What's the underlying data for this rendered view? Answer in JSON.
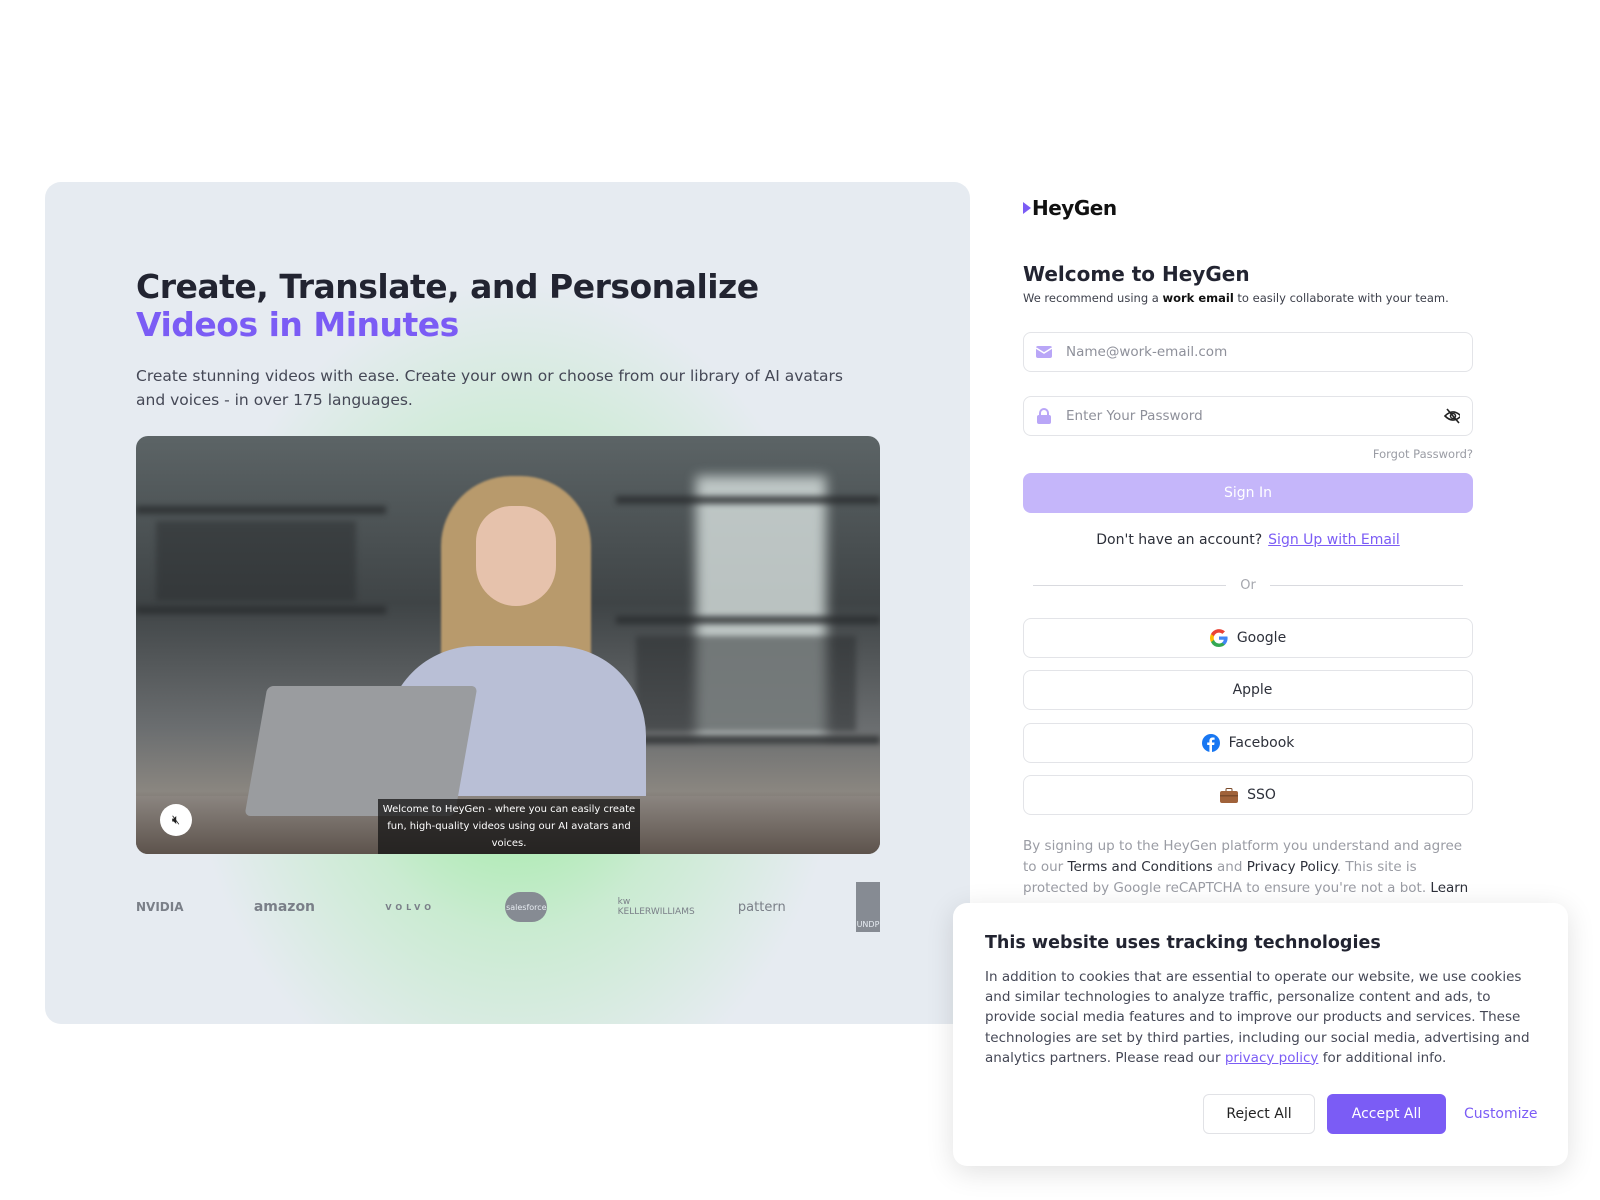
{
  "hero": {
    "title_line1": "Create, Translate, and Personalize",
    "title_line2": "Videos in Minutes",
    "description": "Create stunning videos with ease. Create your own or choose from our library of AI avatars and voices - in over 175 languages.",
    "video": {
      "caption": "Welcome to HeyGen - where you can easily create fun, high-quality videos using our AI avatars and voices.",
      "mute_icon": "speaker-muted-icon"
    },
    "logos": [
      "NVIDIA",
      "amazon",
      "VOLVO",
      "salesforce",
      "kw KELLERWILLIAMS",
      "pattern",
      "UNDP"
    ]
  },
  "auth": {
    "brand": "HeyGen",
    "welcome": "Welcome to HeyGen",
    "rec_prefix": "We recommend using a",
    "rec_bold": "work email",
    "rec_suffix": "to easily collaborate with your team.",
    "email_placeholder": "Name@work-email.com",
    "password_placeholder": "Enter Your Password",
    "forgot": "Forgot Password?",
    "sign_in": "Sign In",
    "no_account": "Don't have an account?",
    "sign_up": "Sign Up with Email",
    "or": "Or",
    "providers": [
      {
        "label": "Google",
        "icon": "google-icon"
      },
      {
        "label": "Apple",
        "icon": "apple-icon"
      },
      {
        "label": "Facebook",
        "icon": "facebook-icon"
      },
      {
        "label": "SSO",
        "icon": "briefcase-icon"
      }
    ],
    "legal": {
      "t1": "By signing up to the HeyGen platform you understand and agree to our",
      "terms": "Terms and Conditions",
      "and": "and",
      "privacy": "Privacy Policy",
      "t2": ". This site is protected by Google reCAPTCHA to ensure you're not a bot.",
      "learn": "Learn more"
    }
  },
  "cookie": {
    "title": "This website uses tracking technologies",
    "body": "In addition to cookies that are essential to operate our website, we use cookies and similar technologies to analyze traffic, personalize content and ads, to provide social media features and to improve our products and services. These technologies are set by third parties, including our social media, advertising and analytics partners. Please read our",
    "link": "privacy policy",
    "body_end": "for additional info.",
    "reject": "Reject All",
    "accept": "Accept All",
    "customize": "Customize"
  },
  "colors": {
    "accent": "#7b5cf5",
    "sign_in_disabled": "#c5b6fa"
  }
}
